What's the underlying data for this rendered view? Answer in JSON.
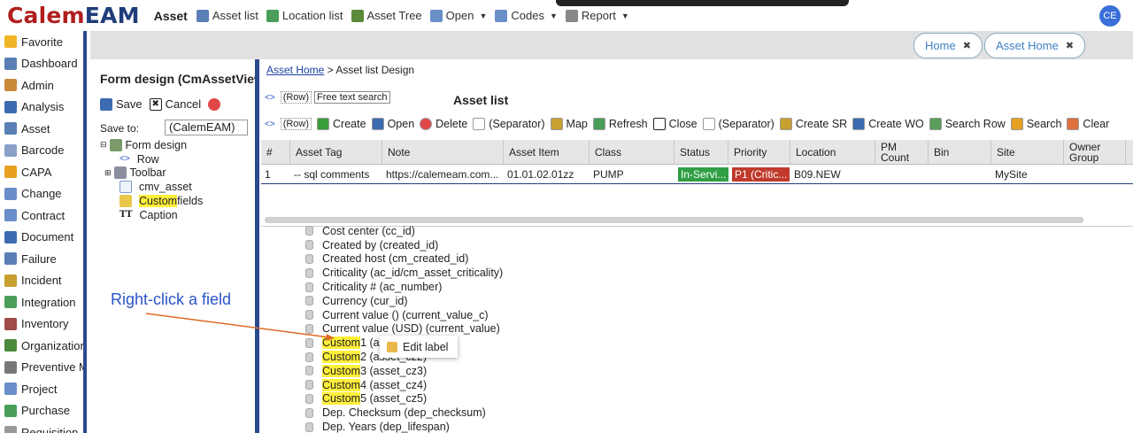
{
  "logo": {
    "part1": "Calem",
    "part2": "EAM"
  },
  "app_name": "Asset",
  "top_menu": [
    {
      "label": "Asset list",
      "icon": "list-icon",
      "dropdown": false
    },
    {
      "label": "Location list",
      "icon": "globe-icon",
      "dropdown": false
    },
    {
      "label": "Asset Tree",
      "icon": "tree-icon",
      "dropdown": false
    },
    {
      "label": "Open",
      "icon": "document-icon",
      "dropdown": true
    },
    {
      "label": "Codes",
      "icon": "document-icon",
      "dropdown": true
    },
    {
      "label": "Report",
      "icon": "report-icon",
      "dropdown": true
    }
  ],
  "user_initials": "CE",
  "sidebar": [
    "Favorite",
    "Dashboard",
    "Admin",
    "Analysis",
    "Asset",
    "Barcode",
    "CAPA",
    "Change",
    "Contract",
    "Document",
    "Failure",
    "Incident",
    "Integration",
    "Inventory",
    "Organization",
    "Preventive Ma",
    "Project",
    "Purchase",
    "Requisition"
  ],
  "tabs": [
    {
      "label": "Home"
    },
    {
      "label": "Asset Home"
    }
  ],
  "left_panel": {
    "title": "Form design (CmAssetViewl",
    "save": "Save",
    "cancel": "Cancel",
    "save_to_label": "Save to:",
    "save_to_value": "(CalemEAM)",
    "tree": [
      {
        "label": "Form design",
        "hl": ""
      },
      {
        "label": "Row",
        "hl": ""
      },
      {
        "label": "Toolbar",
        "hl": ""
      },
      {
        "label": "cmv_asset",
        "hl": ""
      },
      {
        "label": " fields",
        "hl": "Custom"
      },
      {
        "label": "Caption",
        "hl": ""
      }
    ]
  },
  "breadcrumb": {
    "link": "Asset Home",
    "rest": " > Asset list Design"
  },
  "query_row": {
    "chip1": "(Row)",
    "chip2": "Free text search"
  },
  "list_title": "Asset list",
  "toolbar": {
    "chip": "(Row)",
    "items": [
      "Create",
      "Open",
      "Delete",
      "(Separator)",
      "Map",
      "Refresh",
      "Close",
      "(Separator)",
      "Create SR",
      "Create WO",
      "Search Row",
      "Search",
      "Clear"
    ]
  },
  "grid": {
    "headers": [
      "#",
      "Asset Tag",
      "Note",
      "Asset Item",
      "Class",
      "Status",
      "Priority",
      "Location",
      "PM Count",
      "Bin",
      "Site",
      "Owner Group"
    ],
    "row": [
      "1",
      "-- sql comments",
      "https://calemeam.com...",
      "01.01.02.01zz",
      "PUMP",
      "In-Servi...",
      "P1 (Critic...",
      "B09.NEW",
      "",
      "",
      "MySite",
      ""
    ]
  },
  "colors": {
    "status_badge": "#2f9e44",
    "priority_badge": "#c0392b",
    "highlight": "#ffef3a",
    "accent": "#2a4a8f"
  },
  "fields": [
    {
      "hl": "",
      "label": "Cost center (cc_id)"
    },
    {
      "hl": "",
      "label": "Created by (created_id)"
    },
    {
      "hl": "",
      "label": "Created host (cm_created_id)"
    },
    {
      "hl": "",
      "label": "Criticality (ac_id/cm_asset_criticality)"
    },
    {
      "hl": "",
      "label": "Criticality # (ac_number)"
    },
    {
      "hl": "",
      "label": "Currency (cur_id)"
    },
    {
      "hl": "",
      "label": "Current value () (current_value_c)"
    },
    {
      "hl": "",
      "label": "Current value (USD) (current_value)"
    },
    {
      "hl": "Custom",
      "label": " 1 (asset_cz1)"
    },
    {
      "hl": "Custom",
      "label": " 2 (asset_cz2)"
    },
    {
      "hl": "Custom",
      "label": " 3 (asset_cz3)"
    },
    {
      "hl": "Custom",
      "label": " 4 (asset_cz4)"
    },
    {
      "hl": "Custom",
      "label": " 5 (asset_cz5)"
    },
    {
      "hl": "",
      "label": "Dep. Checksum (dep_checksum)"
    },
    {
      "hl": "",
      "label": "Dep. Years (dep_lifespan)"
    }
  ],
  "context_menu": {
    "item": "Edit label"
  },
  "annotation": "Right-click a field"
}
